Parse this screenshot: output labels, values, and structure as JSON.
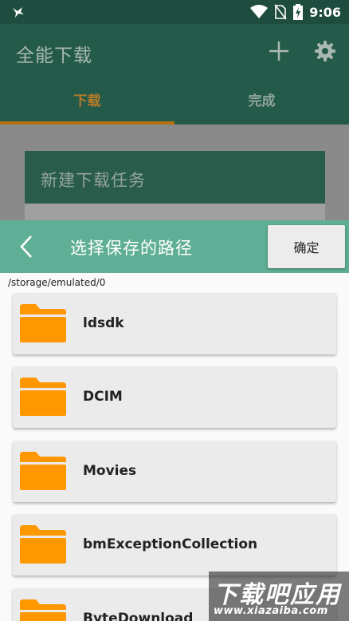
{
  "status_bar": {
    "time": "9:06",
    "icons": [
      "notification-bird-icon",
      "wifi-icon",
      "no-sim-icon",
      "battery-charging-icon"
    ]
  },
  "app_bar": {
    "title": "全能下载",
    "add_icon": "plus-icon",
    "settings_icon": "gear-icon",
    "tabs": [
      {
        "label": "下载",
        "active": true
      },
      {
        "label": "完成",
        "active": false
      }
    ]
  },
  "background": {
    "new_task_label": "新建下载任务"
  },
  "dialog": {
    "title": "选择保存的路径",
    "back_icon": "chevron-left-icon",
    "confirm_label": "确定",
    "current_path": "/storage/emulated/0",
    "folders": [
      {
        "name": "ldsdk"
      },
      {
        "name": "DCIM"
      },
      {
        "name": "Movies"
      },
      {
        "name": "bmExceptionCollection"
      },
      {
        "name": "ByteDownload"
      }
    ]
  },
  "watermark": {
    "title": "下载吧应用",
    "url": "www.xiazaiba.com"
  },
  "colors": {
    "app_bar": "#245a49",
    "dialog_header": "#5fae96",
    "folder": "#ff9800",
    "tab_accent": "#b5720f"
  }
}
